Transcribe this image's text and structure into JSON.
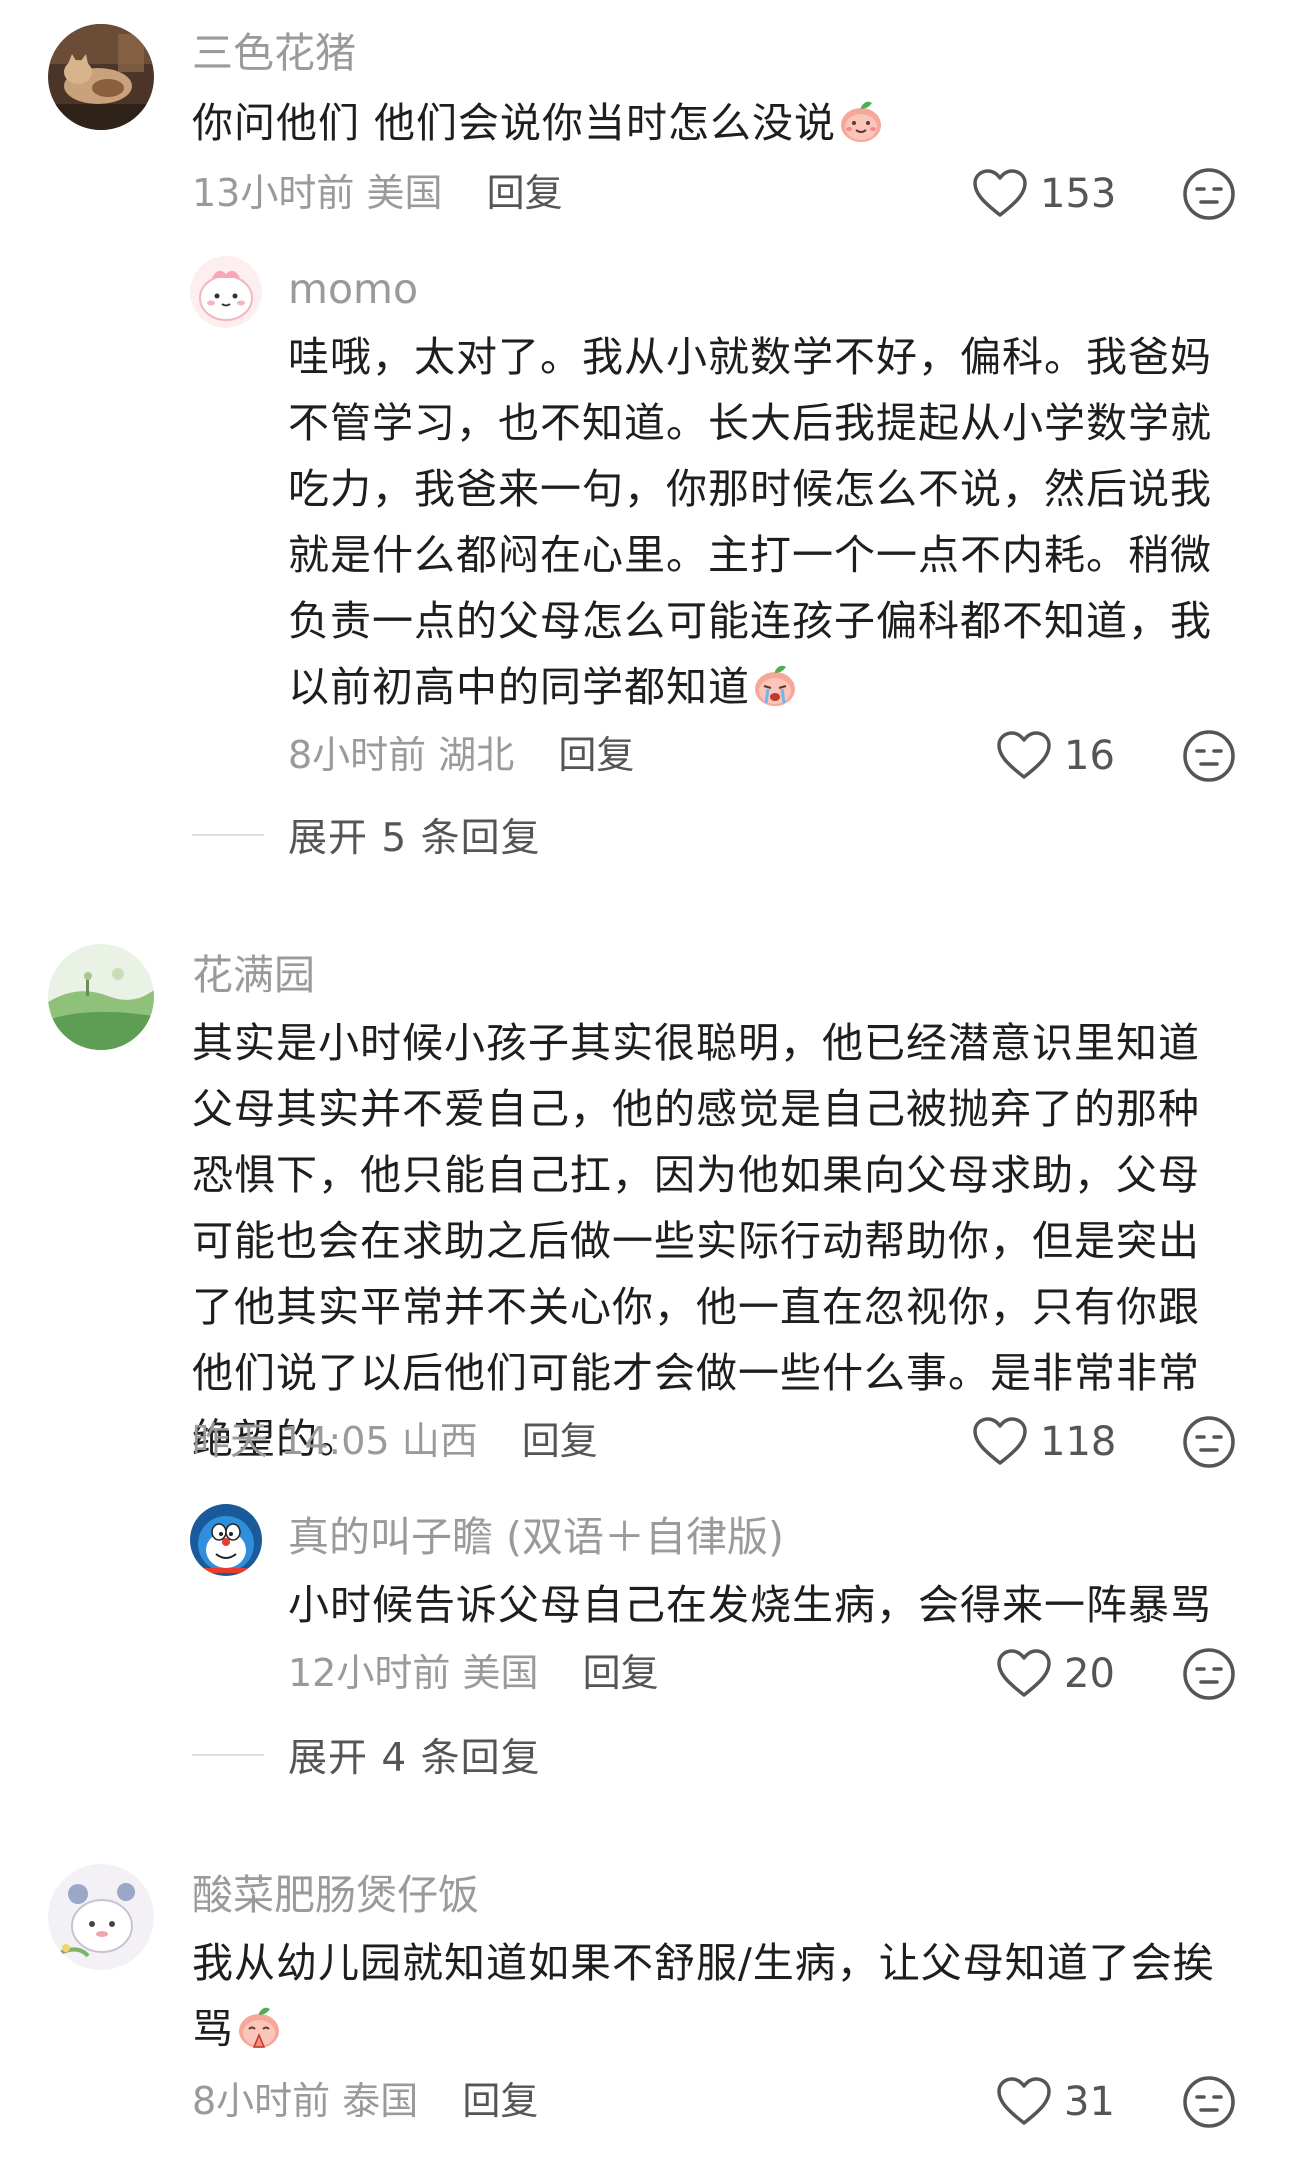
{
  "comments": [
    {
      "username": "三色花猪",
      "text": "你问他们 他们会说你当时怎么没说",
      "emoji": "smiling-peach-emoji",
      "time": "13小时前",
      "location": "美国",
      "reply_label": "回复",
      "likes": "153",
      "replies": [
        {
          "username": "momo",
          "text": "哇哦，太对了。我从小就数学不好，偏科。我爸妈不管学习，也不知道。长大后我提起从小学数学就吃力，我爸来一句，你那时候怎么不说，然后说我就是什么都闷在心里。主打一个一点不内耗。稍微负责一点的父母怎么可能连孩子偏科都不知道，我以前初高中的同学都知道",
          "emoji": "crying-peach-emoji",
          "time": "8小时前",
          "location": "湖北",
          "reply_label": "回复",
          "likes": "16"
        }
      ],
      "expand_label": "展开 5 条回复"
    },
    {
      "username": "花满园",
      "text": "其实是小时候小孩子其实很聪明，他已经潜意识里知道父母其实并不爱自己，他的感觉是自己被抛弃了的那种恐惧下，他只能自己扛，因为他如果向父母求助，父母可能也会在求助之后做一些实际行动帮助你，但是突出了他其实平常并不关心你，他一直在忽视你，只有你跟他们说了以后他们可能才会做一些什么事。是非常非常绝望的。",
      "time": "昨天 14:05",
      "location": "山西",
      "reply_label": "回复",
      "likes": "118",
      "replies": [
        {
          "username": "真的叫子瞻 (双语＋自律版)",
          "text": "小时候告诉父母自己在发烧生病，会得来一阵暴骂",
          "time": "12小时前",
          "location": "美国",
          "reply_label": "回复",
          "likes": "20"
        }
      ],
      "expand_label": "展开 4 条回复"
    },
    {
      "username": "酸菜肥肠煲仔饭",
      "text": "我从幼儿园就知道如果不舒服/生病，让父母知道了会挨骂",
      "emoji": "praying-peach-emoji",
      "time": "8小时前",
      "location": "泰国",
      "reply_label": "回复",
      "likes": "31"
    }
  ]
}
